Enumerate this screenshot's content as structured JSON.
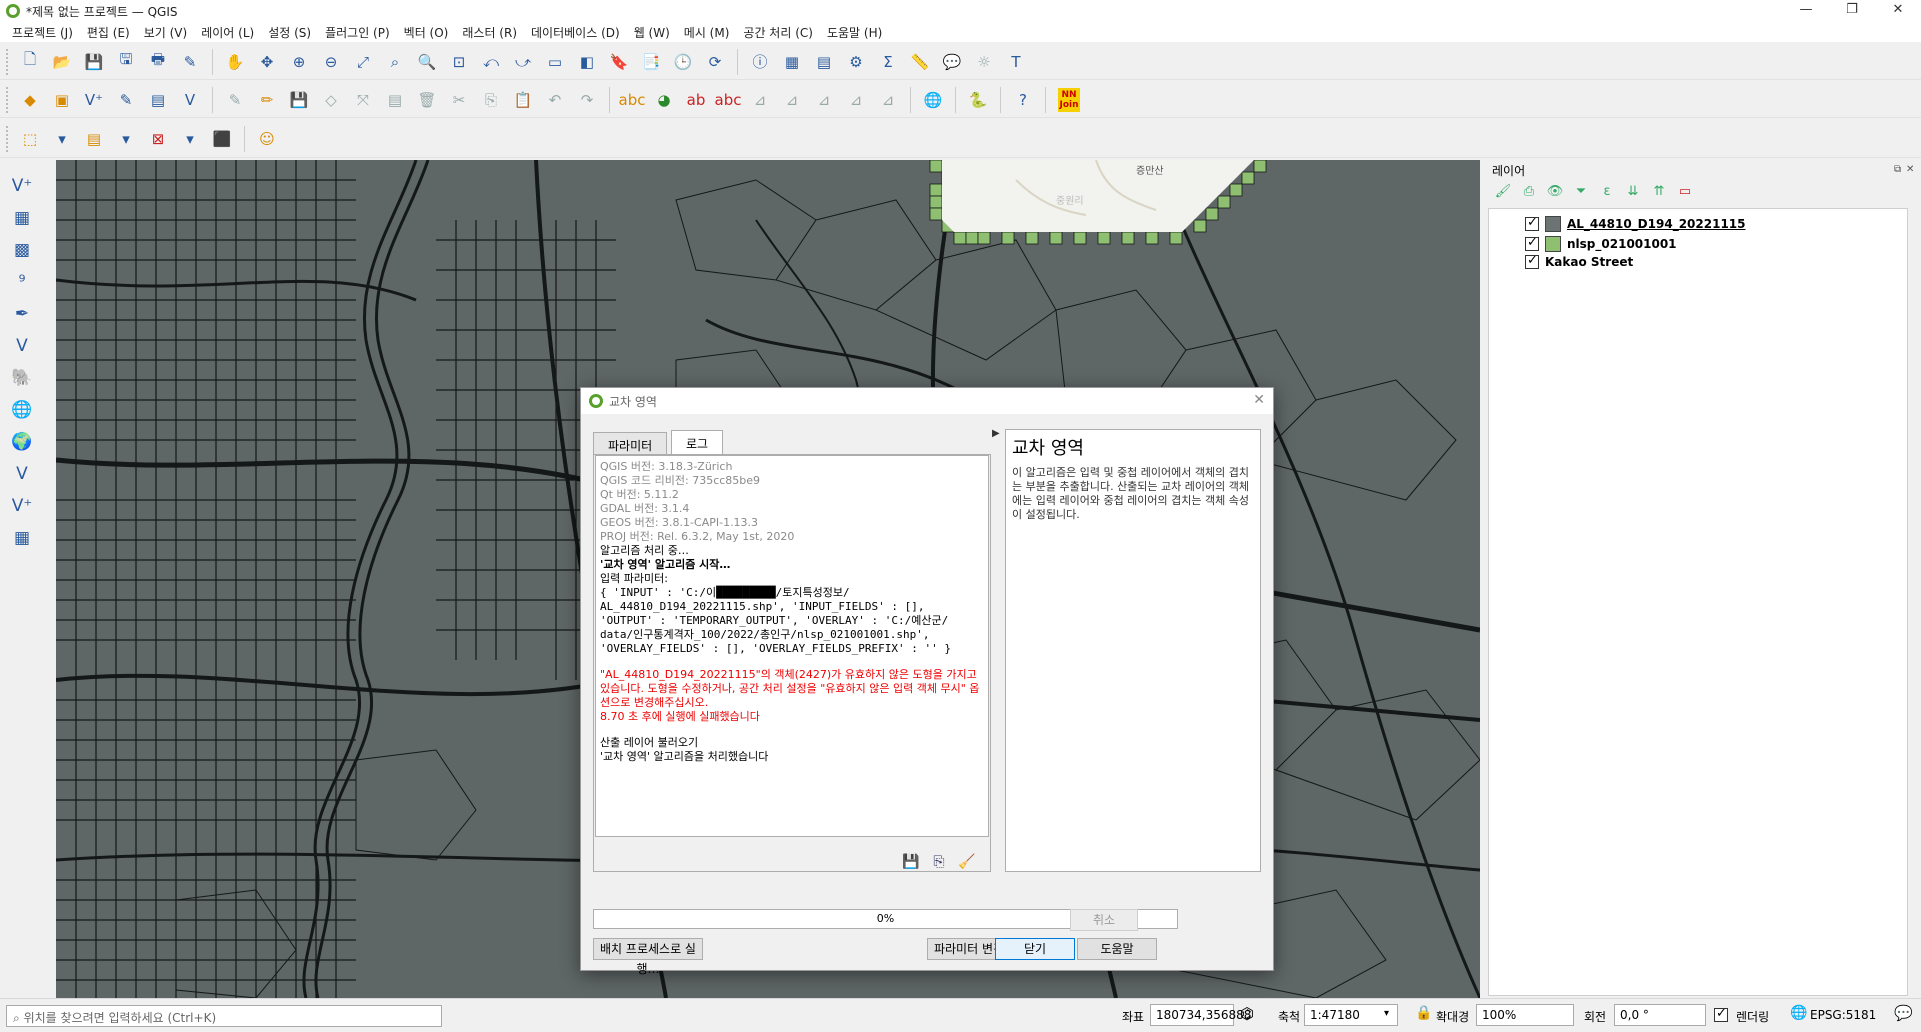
{
  "window": {
    "title": "*제목 없는 프로젝트 — QGIS",
    "minimize": "—",
    "restore": "❐",
    "close": "✕"
  },
  "menu": [
    "프로젝트 (J)",
    "편집 (E)",
    "보기 (V)",
    "레이어 (L)",
    "설정 (S)",
    "플러그인 (P)",
    "벡터 (O)",
    "래스터 (R)",
    "데이터베이스 (D)",
    "웹 (W)",
    "메시 (M)",
    "공간 처리 (C)",
    "도움말 (H)"
  ],
  "toolbar_extra": {
    "nnjoin": "NN\nJoin"
  },
  "map": {
    "labels": [
      "증만산",
      "중원리"
    ],
    "background": "#5f6666",
    "line_color": "#141818",
    "green_overlay": "#8fbf70"
  },
  "layers": {
    "title": "레이어",
    "items": [
      {
        "name": "AL_44810_D194_20221115",
        "swatch": "#6b7373",
        "checked": true,
        "underline": true
      },
      {
        "name": "nlsp_021001001",
        "swatch": "#8fbf70",
        "checked": true
      },
      {
        "name": "Kakao Street",
        "swatch": null,
        "checked": true
      }
    ]
  },
  "status": {
    "locator_placeholder": "위치를 찾으려면 입력하세요 (Ctrl+K)",
    "coord_label": "좌표",
    "coord_value": "180734,356888",
    "scale_label": "축척",
    "scale_value": "1:47180",
    "magnifier_label": "확대경",
    "magnifier_value": "100%",
    "rotation_label": "회전",
    "rotation_value": "0,0 °",
    "render_label": "렌더링",
    "crs": "EPSG:5181"
  },
  "dialog": {
    "title": "교차 영역",
    "tabs": [
      "파라미터",
      "로그"
    ],
    "log": {
      "versions": [
        "QGIS 버전: 3.18.3-Zürich",
        "QGIS 코드 리비전: 735cc85be9",
        "Qt 버전: 5.11.2",
        "GDAL 버전: 3.1.4",
        "GEOS 버전: 3.8.1-CAPI-1.13.3",
        "PROJ 버전: Rel. 6.3.2, May 1st, 2020"
      ],
      "processing": "알고리즘 처리 중…",
      "started": "'교차 영역' 알고리즘 시작…",
      "params_label": "입력 파라미터:",
      "params": "{ 'INPUT' : 'C:/이█████████/토지특성정보/\nAL_44810_D194_20221115.shp', 'INPUT_FIELDS' : [],\n'OUTPUT' : 'TEMPORARY_OUTPUT', 'OVERLAY' : 'C:/예산군/\ndata/인구통계격자_100/2022/총인구/nlsp_021001001.shp',\n'OVERLAY_FIELDS' : [], 'OVERLAY_FIELDS_PREFIX' : '' }",
      "error": "\"AL_44810_D194_20221115\"의 객체(2427)가 유효하지 않은 도형을 가지고 있습니다. 도형을 수정하거나, 공간 처리 설정을 \"유효하지 않은 입력 객체 무시\" 옵션으로 변경해주십시오.",
      "failed": "8.70 초 후에 실행에 실패했습니다",
      "loading": "산출 레이어 불러오기",
      "done": "'교차 영역' 알고리즘을 처리했습니다"
    },
    "help": {
      "title": "교차 영역",
      "text": "이 알고리즘은 입력 및 중첩 레이어에서 객체의 겹치는 부분을 추출합니다. 산출되는 교차 레이어의 객체에는 입력 레이어와 중첩 레이어의 겹치는 객체 속성이 설정됩니다."
    },
    "progress": 0,
    "progress_text": "0%",
    "buttons": {
      "cancel": "취소",
      "batch": "배치 프로세스로 실행…",
      "change_params": "파라미터 변경",
      "close": "닫기",
      "help": "도움말"
    }
  }
}
